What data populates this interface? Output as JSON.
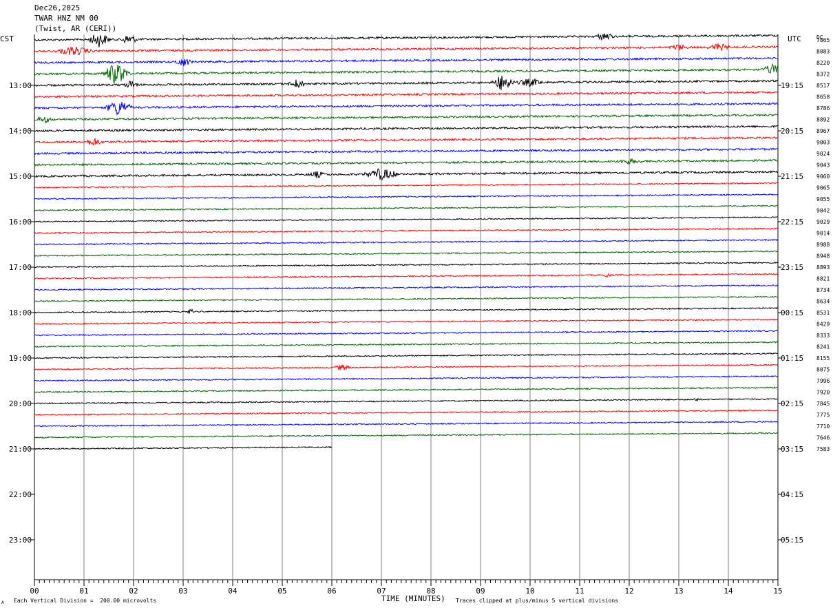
{
  "header": {
    "date": "Dec26,2025",
    "station": "TWAR HNZ NM 00",
    "location": "(Twist, AR (CERI))"
  },
  "left_zone": "CST",
  "right_zone": "UTC",
  "dc_label": "DC",
  "footer": {
    "division_note": "Each Vertical Division =  200.00 microvolts",
    "clip_note": "Traces clipped at plus/minus 5 vertical divisions",
    "corner_mark": "A"
  },
  "chart_data": {
    "type": "line",
    "title": "",
    "xlabel": "TIME (MINUTES)",
    "ylabel": "",
    "xlim": [
      0,
      15
    ],
    "x_ticks": [
      "00",
      "01",
      "02",
      "03",
      "04",
      "05",
      "06",
      "07",
      "08",
      "09",
      "10",
      "11",
      "12",
      "13",
      "14",
      "15"
    ],
    "left_hour_labels": [
      "13:00",
      "14:00",
      "15:00",
      "16:00",
      "17:00",
      "18:00",
      "19:00",
      "20:00",
      "21:00",
      "22:00",
      "23:00"
    ],
    "right_hour_labels": [
      "19:15",
      "20:15",
      "21:15",
      "22:15",
      "23:15",
      "00:15",
      "01:15",
      "02:15",
      "03:15",
      "04:15",
      "05:15"
    ],
    "trace_colors": [
      "#000000",
      "#ff0000",
      "#0000ff",
      "#006400"
    ],
    "dc_offsets": [
      "7865",
      "8083",
      "8220",
      "8372",
      "8517",
      "8658",
      "8786",
      "8892",
      "8967",
      "9003",
      "9024",
      "9043",
      "9060",
      "9065",
      "9055",
      "9042",
      "9029",
      "9014",
      "8988",
      "8948",
      "8893",
      "8821",
      "8734",
      "8634",
      "8531",
      "8429",
      "8333",
      "8241",
      "8155",
      "8075",
      "7996",
      "7920",
      "7845",
      "7775",
      "7710",
      "7646",
      "7583"
    ],
    "last_trace_end_minute": 6.0,
    "grid": true
  }
}
